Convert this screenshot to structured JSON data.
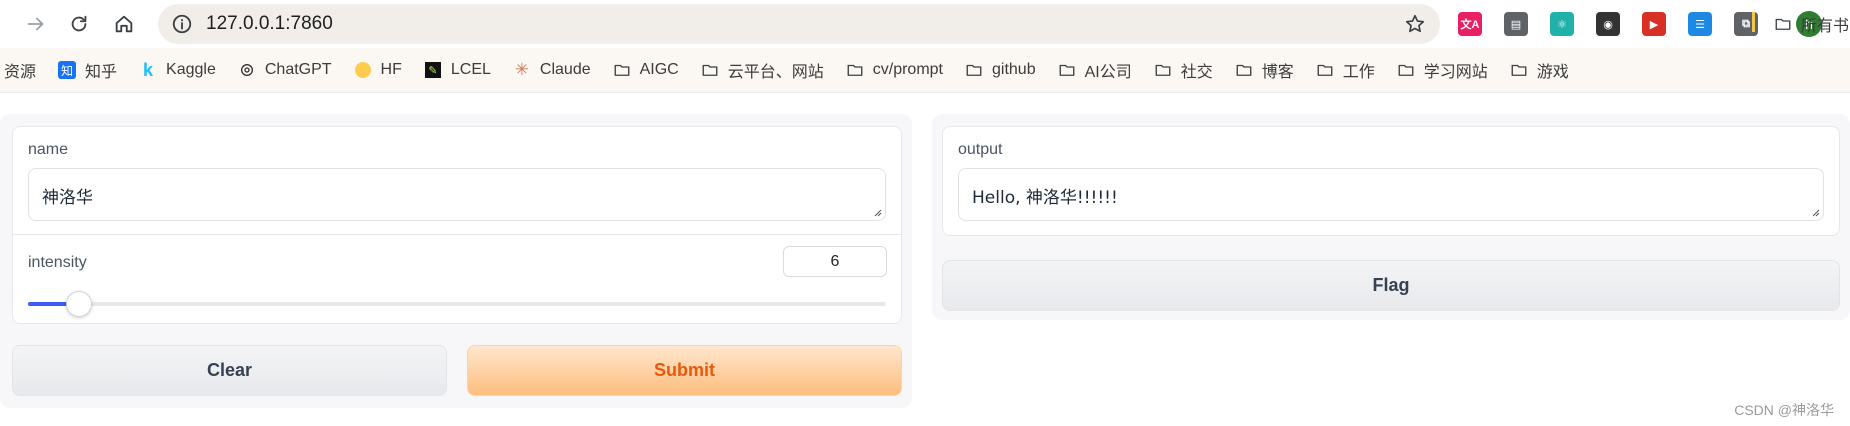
{
  "browser": {
    "url": "127.0.0.1:7860",
    "extensions": [
      {
        "name": "translate-extension-icon",
        "color": "#e91e63",
        "glyph": "文A"
      },
      {
        "name": "media-extension-icon",
        "color": "#5f6368",
        "glyph": "▤"
      },
      {
        "name": "react-devtools-icon",
        "color": "#20b2aa",
        "glyph": "⚛"
      },
      {
        "name": "robot-extension-icon",
        "color": "#333333",
        "glyph": "◉"
      },
      {
        "name": "video-extension-icon",
        "color": "#d93025",
        "glyph": "▶"
      },
      {
        "name": "reader-extension-icon",
        "color": "#1e88e5",
        "glyph": "☰"
      },
      {
        "name": "puzzle-extensions-icon",
        "color": "#5f6368",
        "glyph": "⧉"
      }
    ],
    "avatar_letter": "h",
    "bookmarks": [
      {
        "label": "资源",
        "icon": "none"
      },
      {
        "label": "知乎",
        "icon": "zhihu-icon"
      },
      {
        "label": "Kaggle",
        "icon": "kaggle-icon"
      },
      {
        "label": "ChatGPT",
        "icon": "openai-icon"
      },
      {
        "label": "HF",
        "icon": "huggingface-icon"
      },
      {
        "label": "LCEL",
        "icon": "lcel-icon"
      },
      {
        "label": "Claude",
        "icon": "claude-icon"
      },
      {
        "label": "AIGC",
        "icon": "folder-icon"
      },
      {
        "label": "云平台、网站",
        "icon": "folder-icon"
      },
      {
        "label": "cv/prompt",
        "icon": "folder-icon"
      },
      {
        "label": "github",
        "icon": "folder-icon"
      },
      {
        "label": "AI公司",
        "icon": "folder-icon"
      },
      {
        "label": "社交",
        "icon": "folder-icon"
      },
      {
        "label": "博客",
        "icon": "folder-icon"
      },
      {
        "label": "工作",
        "icon": "folder-icon"
      },
      {
        "label": "学习网站",
        "icon": "folder-icon"
      },
      {
        "label": "游戏",
        "icon": "folder-icon"
      }
    ],
    "all_bookmarks_label": "所有书"
  },
  "app": {
    "inputs": {
      "name_label": "name",
      "name_value": "神洛华",
      "intensity_label": "intensity",
      "intensity_value": "6",
      "intensity_fraction": 0.06
    },
    "outputs": {
      "output_label": "output",
      "output_value": "Hello, 神洛华!!!!!!"
    },
    "buttons": {
      "clear": "Clear",
      "submit": "Submit",
      "flag": "Flag"
    },
    "colors": {
      "accent": "#3b5bf6",
      "primary_text": "#ea580c",
      "primary_bg": "#fdbd7e"
    }
  },
  "watermark": "CSDN @神洛华"
}
